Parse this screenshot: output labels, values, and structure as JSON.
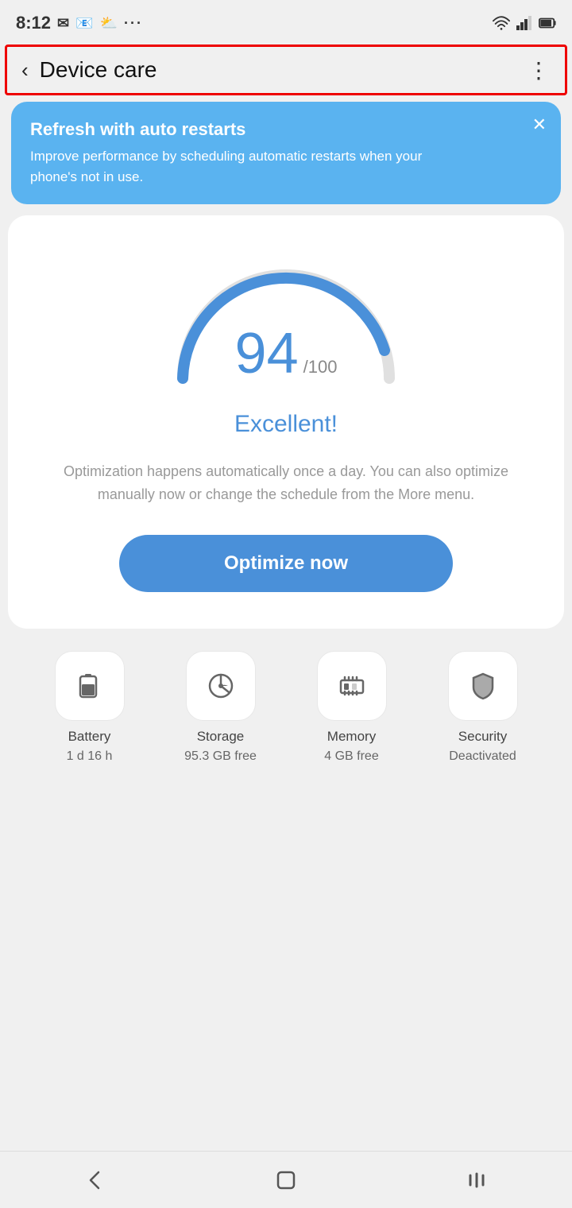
{
  "statusBar": {
    "time": "8:12",
    "icons": [
      "message",
      "mail",
      "weather",
      "more"
    ]
  },
  "appBar": {
    "title": "Device care",
    "backLabel": "‹",
    "moreLabel": "⋮"
  },
  "banner": {
    "title": "Refresh with auto restarts",
    "description": "Improve performance by scheduling automatic restarts when your phone's not in use.",
    "closeLabel": "✕"
  },
  "scoreCard": {
    "score": "94",
    "total": "/100",
    "label": "Excellent!",
    "hintText": "Optimization happens automatically once a day. You can also optimize manually now or change the schedule from the More menu.",
    "optimizeButtonLabel": "Optimize now"
  },
  "bottomIcons": [
    {
      "name": "Battery",
      "value": "1 d 16 h",
      "iconType": "battery"
    },
    {
      "name": "Storage",
      "value": "95.3 GB free",
      "iconType": "storage"
    },
    {
      "name": "Memory",
      "value": "4 GB free",
      "iconType": "memory"
    },
    {
      "name": "Security",
      "value": "Deactivated",
      "iconType": "security"
    }
  ],
  "navBar": {
    "backLabel": "‹",
    "homeLabel": "○",
    "recentLabel": "|||"
  }
}
